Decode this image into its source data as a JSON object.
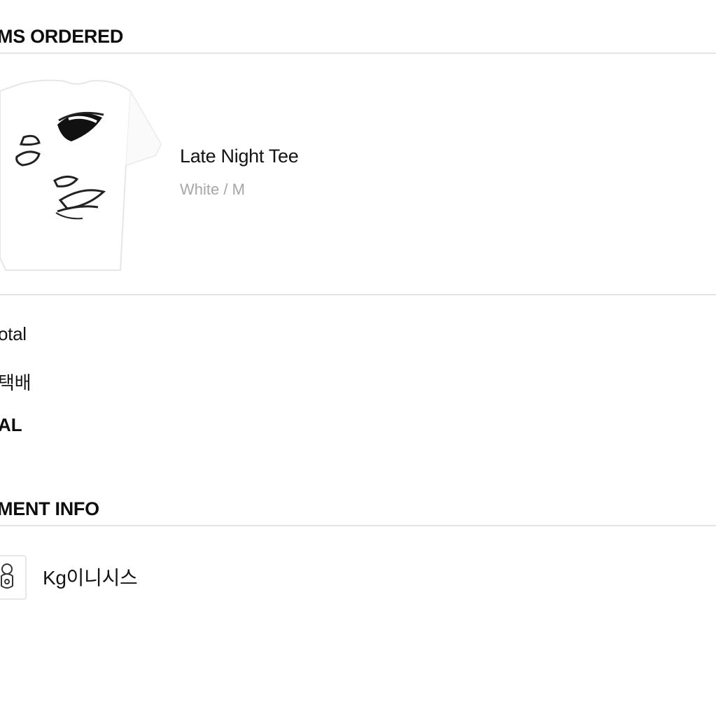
{
  "items_ordered": {
    "heading": "MS ORDERED",
    "product": {
      "image_icon": "tshirt-with-face-print",
      "name": "Late Night Tee",
      "variant": "White / M"
    }
  },
  "summary": {
    "subtotal_label": "otal",
    "shipping_label": "택배",
    "total_label": "AL"
  },
  "payment_info": {
    "heading": "MENT INFO",
    "logo_icon": "payment-provider-logo",
    "method": "Kg이니시스"
  }
}
